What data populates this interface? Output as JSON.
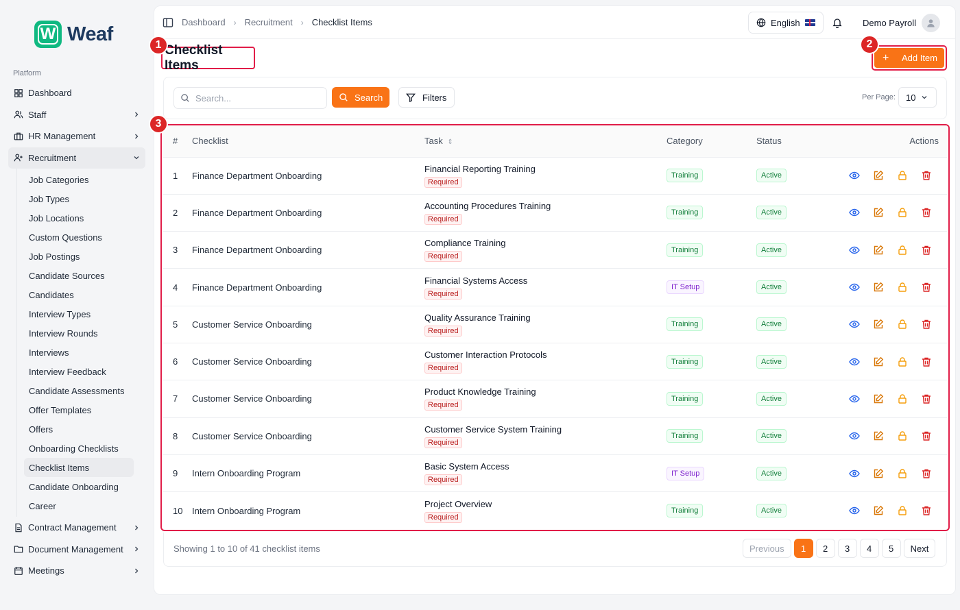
{
  "brand": {
    "name": "Weaf",
    "mark": "W"
  },
  "sidebar": {
    "section_label": "Platform",
    "items": [
      {
        "label": "Dashboard",
        "icon": "grid-icon"
      },
      {
        "label": "Staff",
        "icon": "users-icon"
      },
      {
        "label": "HR Management",
        "icon": "briefcase-icon"
      },
      {
        "label": "Recruitment",
        "icon": "user-plus-icon"
      }
    ],
    "recruitment_sub": [
      "Job Categories",
      "Job Types",
      "Job Locations",
      "Custom Questions",
      "Job Postings",
      "Candidate Sources",
      "Candidates",
      "Interview Types",
      "Interview Rounds",
      "Interviews",
      "Interview Feedback",
      "Candidate Assessments",
      "Offer Templates",
      "Offers",
      "Onboarding Checklists",
      "Checklist Items",
      "Candidate Onboarding",
      "Career"
    ],
    "bottom_items": [
      {
        "label": "Contract Management",
        "icon": "file-icon"
      },
      {
        "label": "Document Management",
        "icon": "folder-icon"
      },
      {
        "label": "Meetings",
        "icon": "calendar-icon"
      }
    ]
  },
  "breadcrumb": [
    "Dashboard",
    "Recruitment",
    "Checklist Items"
  ],
  "header": {
    "language": "English",
    "user_name": "Demo Payroll"
  },
  "page": {
    "title": "Checklist Items",
    "add_label": "Add Item"
  },
  "callouts": [
    "1",
    "2",
    "3"
  ],
  "toolbar": {
    "search_placeholder": "Search...",
    "search_label": "Search",
    "filters_label": "Filters",
    "per_page_label": "Per Page:",
    "per_page_value": "10"
  },
  "table": {
    "columns": [
      "#",
      "Checklist",
      "Task",
      "Category",
      "Status",
      "Actions"
    ],
    "rows": [
      {
        "num": "1",
        "checklist": "Finance Department Onboarding",
        "task": "Financial Reporting Training",
        "required": "Required",
        "category": "Training",
        "status": "Active"
      },
      {
        "num": "2",
        "checklist": "Finance Department Onboarding",
        "task": "Accounting Procedures Training",
        "required": "Required",
        "category": "Training",
        "status": "Active"
      },
      {
        "num": "3",
        "checklist": "Finance Department Onboarding",
        "task": "Compliance Training",
        "required": "Required",
        "category": "Training",
        "status": "Active"
      },
      {
        "num": "4",
        "checklist": "Finance Department Onboarding",
        "task": "Financial Systems Access",
        "required": "Required",
        "category": "IT Setup",
        "status": "Active"
      },
      {
        "num": "5",
        "checklist": "Customer Service Onboarding",
        "task": "Quality Assurance Training",
        "required": "Required",
        "category": "Training",
        "status": "Active"
      },
      {
        "num": "6",
        "checklist": "Customer Service Onboarding",
        "task": "Customer Interaction Protocols",
        "required": "Required",
        "category": "Training",
        "status": "Active"
      },
      {
        "num": "7",
        "checklist": "Customer Service Onboarding",
        "task": "Product Knowledge Training",
        "required": "Required",
        "category": "Training",
        "status": "Active"
      },
      {
        "num": "8",
        "checklist": "Customer Service Onboarding",
        "task": "Customer Service System Training",
        "required": "Required",
        "category": "Training",
        "status": "Active"
      },
      {
        "num": "9",
        "checklist": "Intern Onboarding Program",
        "task": "Basic System Access",
        "required": "Required",
        "category": "IT Setup",
        "status": "Active"
      },
      {
        "num": "10",
        "checklist": "Intern Onboarding Program",
        "task": "Project Overview",
        "required": "Required",
        "category": "Training",
        "status": "Active"
      }
    ]
  },
  "pagination": {
    "showing_text": "Showing 1 to 10 of 41 checklist items",
    "previous": "Previous",
    "next": "Next",
    "pages": [
      "1",
      "2",
      "3",
      "4",
      "5"
    ],
    "current": "1"
  },
  "colors": {
    "accent": "#f97316",
    "brand": "#10b981",
    "callout": "#dc2626"
  }
}
